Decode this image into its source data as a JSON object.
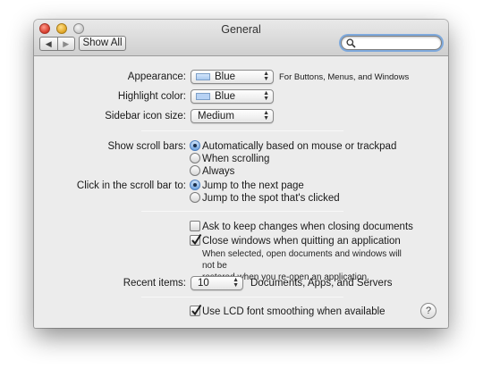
{
  "window": {
    "title": "General"
  },
  "toolbar": {
    "back_glyph": "◀",
    "forward_glyph": "▶",
    "show_all_label": "Show All",
    "search_placeholder": ""
  },
  "appearance": {
    "label": "Appearance:",
    "value": "Blue",
    "note": "For Buttons, Menus, and Windows"
  },
  "highlight": {
    "label": "Highlight color:",
    "value": "Blue"
  },
  "sidebar_icon": {
    "label": "Sidebar icon size:",
    "value": "Medium"
  },
  "scroll_bars": {
    "label": "Show scroll bars:",
    "options": [
      "Automatically based on mouse or trackpad",
      "When scrolling",
      "Always"
    ],
    "selected": 0
  },
  "click_scroll": {
    "label": "Click in the scroll bar to:",
    "options": [
      "Jump to the next page",
      "Jump to the spot that's clicked"
    ],
    "selected": 0
  },
  "ask_keep_changes": {
    "label": "Ask to keep changes when closing documents",
    "checked": false
  },
  "close_windows": {
    "label": "Close windows when quitting an application",
    "checked": true,
    "note_line1": "When selected, open documents and windows will not be",
    "note_line2": "restored when you re-open an application."
  },
  "recent_items": {
    "label": "Recent items:",
    "value": "10",
    "suffix": "Documents, Apps, and Servers"
  },
  "lcd_smoothing": {
    "label": "Use LCD font smoothing when available",
    "checked": true
  },
  "help": {
    "glyph": "?"
  },
  "colors": {
    "accent": "#6fa3df",
    "window_bg": "#ececec"
  }
}
